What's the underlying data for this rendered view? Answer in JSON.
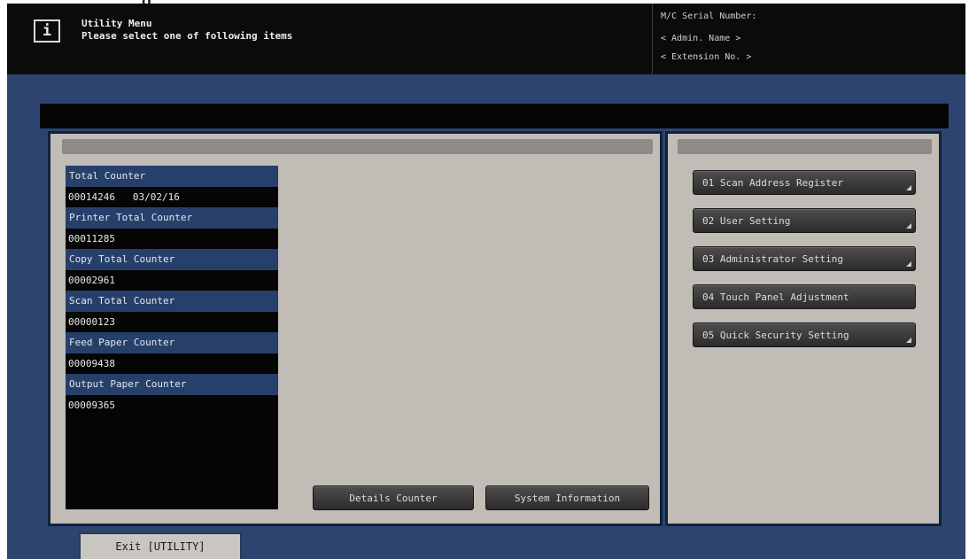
{
  "header": {
    "title": "Utility Menu",
    "subtitle": "Please select one of following items",
    "info_icon_glyph": "i",
    "serial_label": "M/C Serial Number:",
    "admin_name_label": "< Admin. Name >",
    "extension_label": "< Extension No. >"
  },
  "counters": [
    {
      "label": "Total Counter",
      "value": "00014246   03/02/16"
    },
    {
      "label": "Printer Total Counter",
      "value": "00011285"
    },
    {
      "label": "Copy Total Counter",
      "value": "00002961"
    },
    {
      "label": "Scan Total Counter",
      "value": "00000123"
    },
    {
      "label": "Feed Paper Counter",
      "value": "00009438"
    },
    {
      "label": "Output Paper Counter",
      "value": "00009365"
    }
  ],
  "buttons": {
    "details_counter": "Details Counter",
    "system_information": "System Information"
  },
  "menu_items": [
    {
      "label": "01 Scan Address Register"
    },
    {
      "label": "02 User Setting"
    },
    {
      "label": "03 Administrator Setting"
    },
    {
      "label": "04 Touch Panel Adjustment"
    },
    {
      "label": "05 Quick Security Setting"
    }
  ],
  "footer": {
    "exit_label": "Exit [UTILITY]"
  },
  "colors": {
    "frame_blue": "#2e4470",
    "panel_gray": "#c1bcb6",
    "counter_label_blue": "#27406b",
    "header_black": "#0b0b0b"
  },
  "icons": [
    "info-icon",
    "submenu-corner-icon"
  ]
}
